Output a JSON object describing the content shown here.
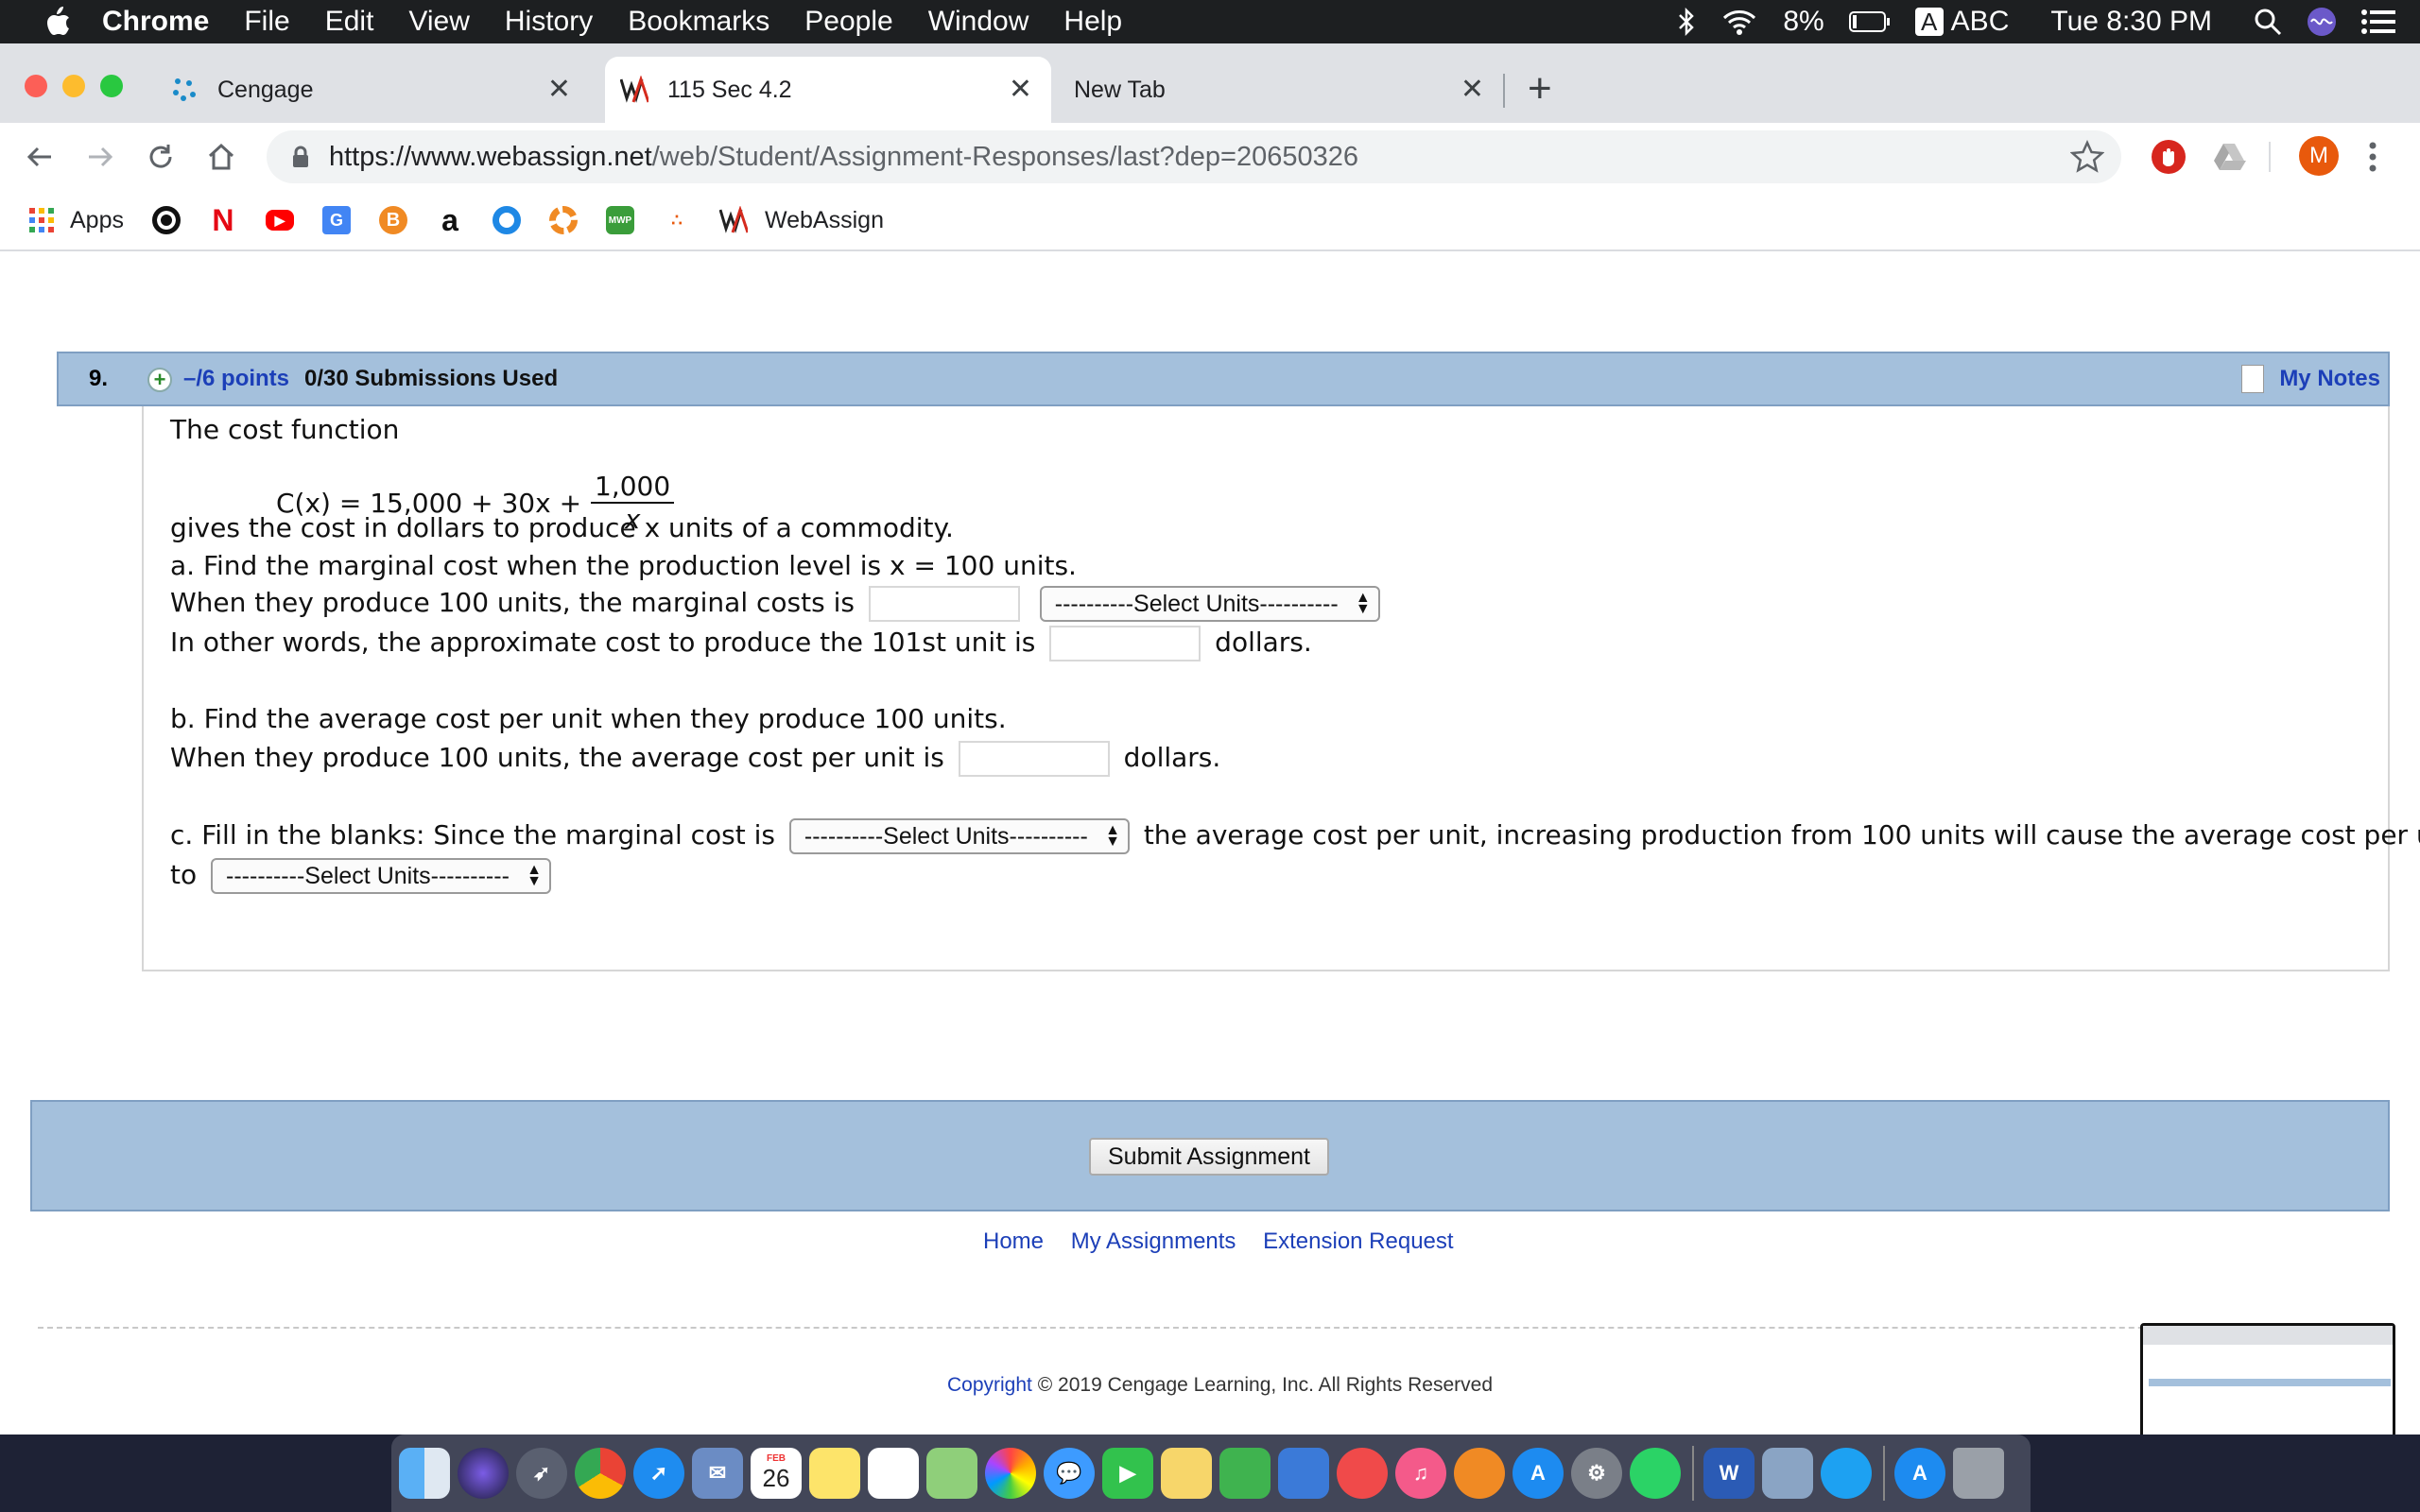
{
  "menubar": {
    "app": "Chrome",
    "items": [
      "File",
      "Edit",
      "View",
      "History",
      "Bookmarks",
      "People",
      "Window",
      "Help"
    ],
    "battery": "8%",
    "input_source_letter": "A",
    "input_source": "ABC",
    "clock": "Tue 8:30 PM"
  },
  "tabs": [
    {
      "title": "Cengage",
      "icon": "cengage-icon"
    },
    {
      "title": "115 Sec 4.2",
      "icon": "webassign-icon"
    },
    {
      "title": "New Tab",
      "icon": ""
    }
  ],
  "address": {
    "host": "https://www.webassign.net",
    "path": "/web/Student/Assignment-Responses/last?dep=20650326"
  },
  "profile_initial": "M",
  "bookmarks": {
    "apps_label": "Apps",
    "webassign_label": "WebAssign",
    "amazon_letter": "a",
    "netflix_letter": "N"
  },
  "question": {
    "number": "9.",
    "points": "–/6 points",
    "submissions": "0/30 Submissions Used",
    "my_notes": "My Notes",
    "intro": "The cost function",
    "formula_left": "C(x) = 15,000 + 30x +",
    "formula_num": "1,000",
    "formula_den": "x",
    "gives": "gives the cost in dollars to produce x units of a commodity.",
    "a_prompt": "a. Find the marginal cost when the production level is x = 100 units.",
    "a_line1": "When they produce 100 units, the marginal costs is",
    "a_line2": "In other words, the approximate cost to produce the 101st unit is",
    "dollars": "dollars.",
    "b_prompt": "b. Find the average cost per unit when they produce 100 units.",
    "b_line": "When they produce 100 units, the average cost per unit is",
    "c_line_start": "c. Fill in the blanks: Since the marginal cost is",
    "c_line_mid": "the average cost per unit, increasing production from 100 units will cause the average cost per unit",
    "c_line_end": "to",
    "select_placeholder": "----------Select Units----------"
  },
  "submit_label": "Submit Assignment",
  "footer_links": [
    "Home",
    "My Assignments",
    "Extension Request"
  ],
  "copyright_link": "Copyright",
  "copyright_text": "© 2019 Cengage Learning, Inc. All Rights Reserved",
  "dock_calendar_month": "FEB",
  "dock_calendar_day": "26",
  "dock_word_letter": "W"
}
